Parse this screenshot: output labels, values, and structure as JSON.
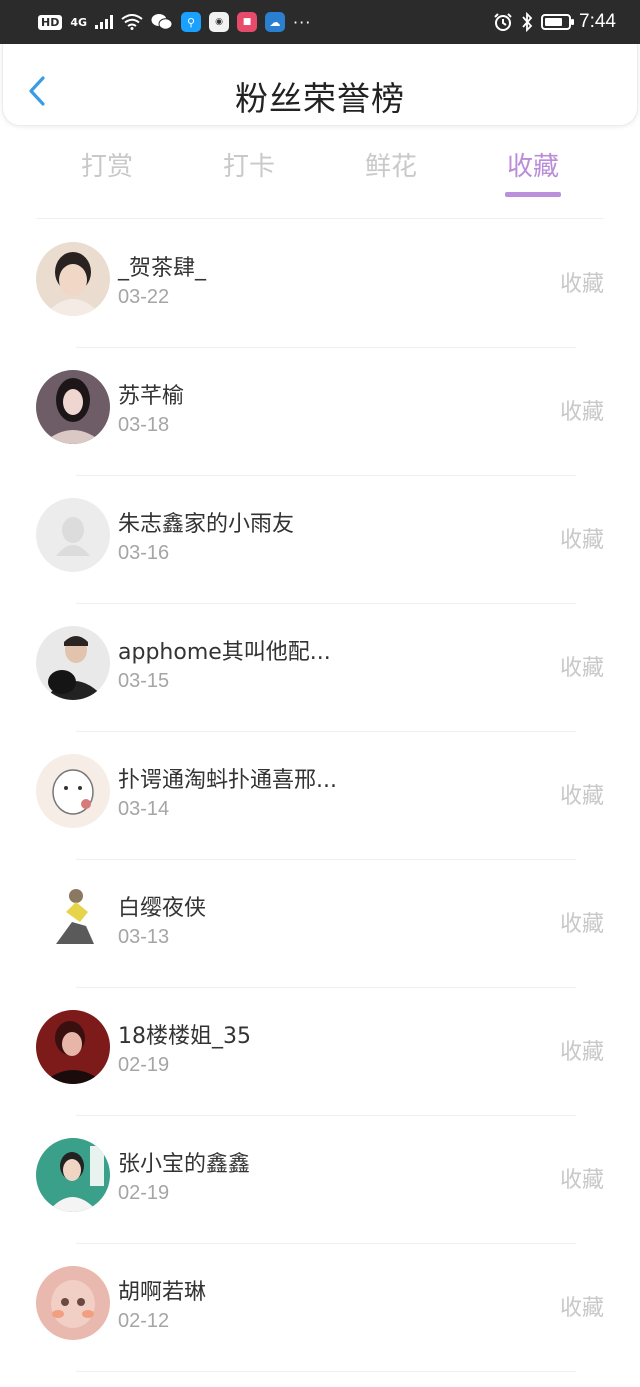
{
  "status_bar": {
    "hd_label": "HD",
    "network_label": "4G",
    "time": "7:44",
    "more": "···",
    "battery_percent": 80,
    "icons": [
      "hd-icon",
      "signal-icon",
      "wifi-icon",
      "wechat-icon",
      "search-app-icon",
      "huawei-app-icon",
      "shop-app-icon",
      "cloud-app-icon",
      "alarm-icon",
      "bluetooth-icon",
      "battery-icon"
    ]
  },
  "header": {
    "title": "粉丝荣誉榜",
    "back_icon": "chevron-left-icon",
    "accent_color": "#3a9ce6"
  },
  "tabs": {
    "items": [
      {
        "label": "打赏"
      },
      {
        "label": "打卡"
      },
      {
        "label": "鲜花"
      },
      {
        "label": "收藏"
      }
    ],
    "active_index": 3,
    "active_color": "#b98dd8"
  },
  "list": {
    "action_label": "收藏",
    "rows": [
      {
        "name": "_贺茶肆_",
        "date": "03-22",
        "action": "收藏"
      },
      {
        "name": "苏芊榆",
        "date": "03-18",
        "action": "收藏"
      },
      {
        "name": "朱志鑫家的小雨友",
        "date": "03-16",
        "action": "收藏"
      },
      {
        "name": "apphome其叫他配...",
        "date": "03-15",
        "action": "收藏"
      },
      {
        "name": "扑谔通淘蚪扑通喜邢...",
        "date": "03-14",
        "action": "收藏"
      },
      {
        "name": "白缨夜侠",
        "date": "03-13",
        "action": "收藏"
      },
      {
        "name": "18楼楼姐_35",
        "date": "02-19",
        "action": "收藏"
      },
      {
        "name": "张小宝的鑫鑫",
        "date": "02-19",
        "action": "收藏"
      },
      {
        "name": "胡啊若琳",
        "date": "02-12",
        "action": "收藏"
      }
    ]
  },
  "avatar_colors": [
    "#e8d8cc",
    "#6b5560",
    "#ececec",
    "#2d2d2d",
    "#f5ebe4",
    "#ffffff",
    "#8a1d1d",
    "#3a9c8a",
    "#e8b9b0"
  ]
}
